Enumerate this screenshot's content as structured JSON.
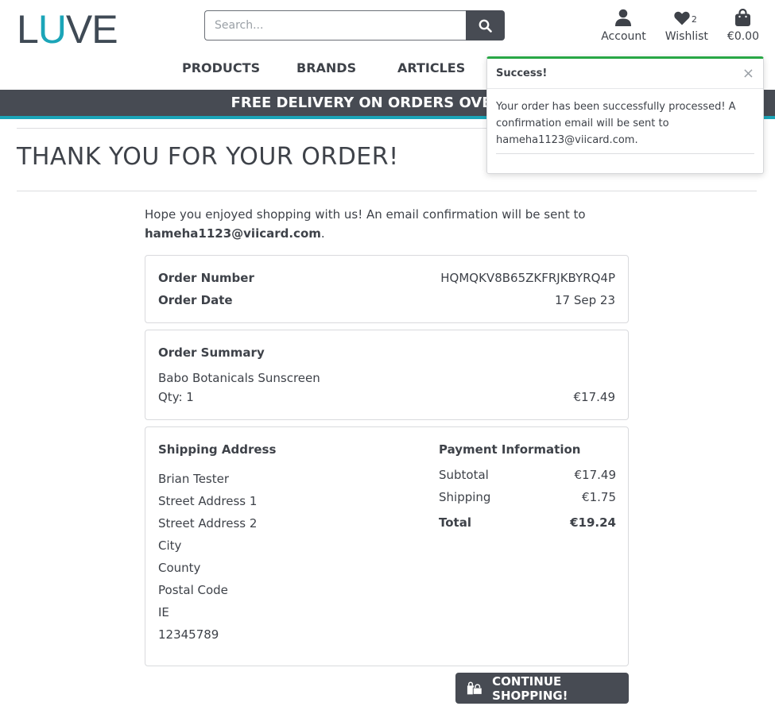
{
  "brand": {
    "logo_part1": "L",
    "logo_part2": "U",
    "logo_part3": "VE"
  },
  "search": {
    "placeholder": "Search..."
  },
  "header": {
    "account_label": "Account",
    "wishlist_label": "Wishlist",
    "wishlist_count": "2",
    "cart_total": "€0.00"
  },
  "nav": {
    "products": "PRODUCTS",
    "brands": "BRANDS",
    "articles": "ARTICLES"
  },
  "banner": {
    "text": "FREE DELIVERY ON ORDERS OVER €50!"
  },
  "page": {
    "title": "THANK YOU FOR YOUR ORDER!"
  },
  "intro": {
    "text": "Hope you enjoyed shopping with us! An email confirmation will be sent to",
    "email": "hameha1123@viicard.com",
    "period": "."
  },
  "order": {
    "number_label": "Order Number",
    "number_value": "HQMQKV8B65ZKFRJKBYRQ4P",
    "date_label": "Order Date",
    "date_value": "17 Sep 23"
  },
  "summary": {
    "heading": "Order Summary",
    "product": "Babo Botanicals Sunscreen",
    "qty": "Qty: 1",
    "price": "€17.49"
  },
  "shipping": {
    "heading": "Shipping Address",
    "lines": [
      "Brian Tester",
      "Street Address 1",
      "Street Address 2",
      "City",
      "County",
      "Postal Code",
      "IE",
      "12345789"
    ]
  },
  "payment": {
    "heading": "Payment Information",
    "subtotal_label": "Subtotal",
    "subtotal_value": "€17.49",
    "shipping_label": "Shipping",
    "shipping_value": "€1.75",
    "total_label": "Total",
    "total_value": "€19.24"
  },
  "continue_button": {
    "label": "CONTINUE SHOPPING!"
  },
  "toast": {
    "title": "Success!",
    "close": "×",
    "message": "Your order has been successfully processed! A confirmation email will be sent to hameha1123@viicard.com."
  },
  "colors": {
    "accent": "#1ba5b8",
    "dark": "#474b53",
    "success": "#28a745"
  }
}
